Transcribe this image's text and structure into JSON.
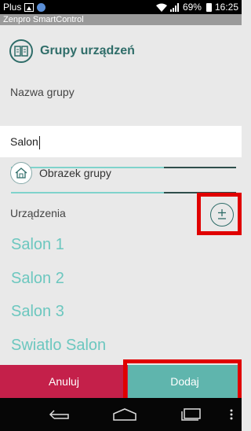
{
  "status_bar": {
    "carrier": "Plus",
    "battery": "69%",
    "time": "16:25"
  },
  "app_title": "Zenpro SmartControl",
  "header": {
    "title": "Grupy urządzeń"
  },
  "form": {
    "name_label": "Nazwa grupy",
    "name_value": "Salon",
    "image_label": "Obrazek grupy",
    "devices_label": "Urządzenia"
  },
  "devices": [
    {
      "label": "Salon 1"
    },
    {
      "label": "Salon 2"
    },
    {
      "label": "Salon 3"
    },
    {
      "label": "Swiatlo Salon"
    }
  ],
  "buttons": {
    "cancel": "Anuluj",
    "add": "Dodaj"
  },
  "colors": {
    "accent": "#2f6d69",
    "device_text": "#6cc7bf",
    "cancel_bg": "#c4204a",
    "add_bg": "#5fb5ad",
    "highlight": "#e00000"
  }
}
